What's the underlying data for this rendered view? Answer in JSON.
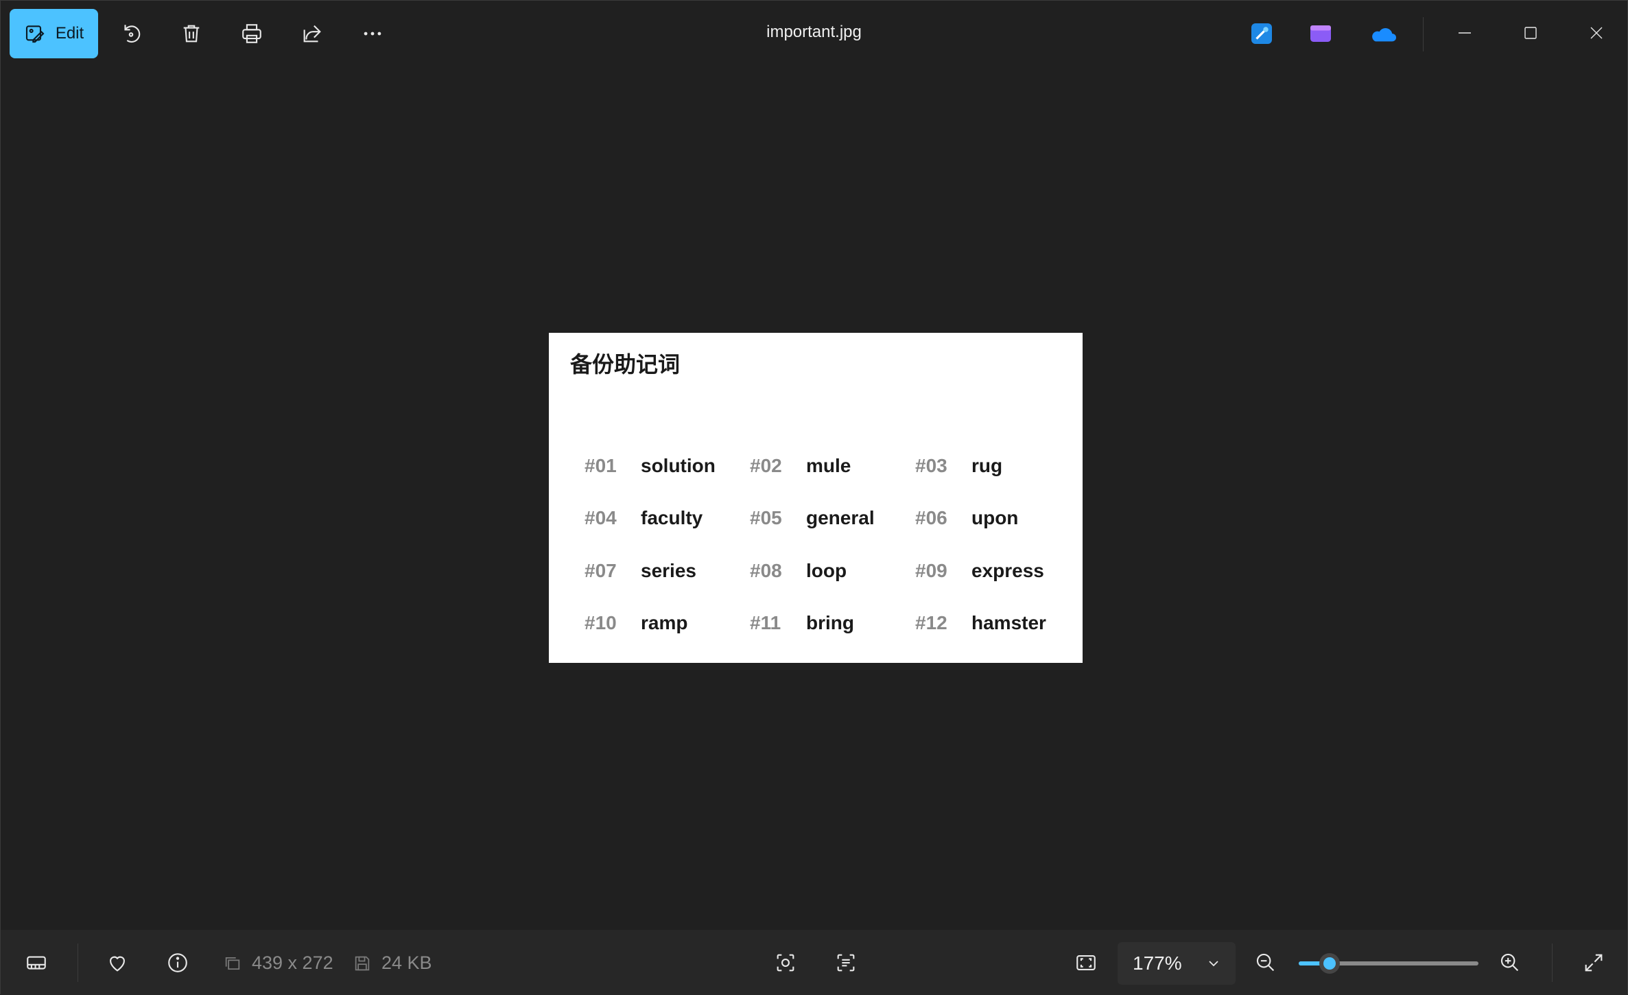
{
  "window": {
    "title": "important.jpg"
  },
  "toolbar": {
    "edit_label": "Edit",
    "buttons": [
      "rotate-icon",
      "delete-icon",
      "print-icon",
      "share-icon",
      "more-icon"
    ],
    "apps": [
      "designer-app-icon",
      "clipchamp-app-icon",
      "onedrive-icon"
    ]
  },
  "image": {
    "title": "备份助记词",
    "words": [
      {
        "num": "#01",
        "word": "solution"
      },
      {
        "num": "#02",
        "word": "mule"
      },
      {
        "num": "#03",
        "word": "rug"
      },
      {
        "num": "#04",
        "word": "faculty"
      },
      {
        "num": "#05",
        "word": "general"
      },
      {
        "num": "#06",
        "word": "upon"
      },
      {
        "num": "#07",
        "word": "series"
      },
      {
        "num": "#08",
        "word": "loop"
      },
      {
        "num": "#09",
        "word": "express"
      },
      {
        "num": "#10",
        "word": "ramp"
      },
      {
        "num": "#11",
        "word": "bring"
      },
      {
        "num": "#12",
        "word": "hamster"
      }
    ]
  },
  "status": {
    "dimensions": "439 x 272",
    "file_size": "24 KB",
    "zoom": "177%",
    "zoom_fraction": 0.17
  },
  "colors": {
    "accent": "#4cc2ff",
    "background": "#202020",
    "bar": "#272727"
  }
}
